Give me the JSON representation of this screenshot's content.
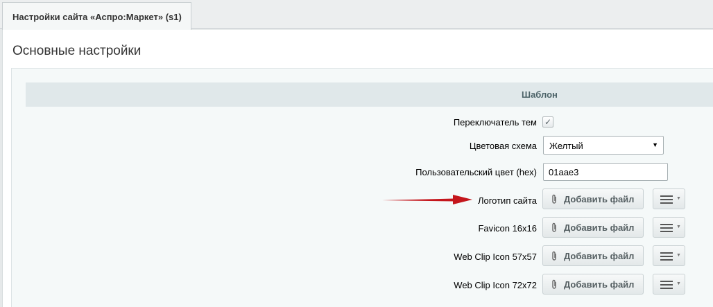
{
  "tab": {
    "label": "Настройки сайта «Аспро:Маркет» (s1)"
  },
  "page": {
    "title": "Основные настройки"
  },
  "section": {
    "title": "Шаблон"
  },
  "fields": {
    "theme_switcher": {
      "label": "Переключатель тем",
      "checked": true
    },
    "color_scheme": {
      "label": "Цветовая схема",
      "value": "Желтый"
    },
    "custom_color": {
      "label": "Пользовательский цвет (hex)",
      "value": "01aae3"
    },
    "logo": {
      "label": "Логотип сайта",
      "button": "Добавить файл"
    },
    "favicon": {
      "label": "Favicon 16x16",
      "button": "Добавить файл"
    },
    "webclip57": {
      "label": "Web Clip Icon 57x57",
      "button": "Добавить файл"
    },
    "webclip72": {
      "label": "Web Clip Icon 72x72",
      "button": "Добавить файл"
    }
  },
  "colors": {
    "annotation_arrow": "#c4161c"
  }
}
